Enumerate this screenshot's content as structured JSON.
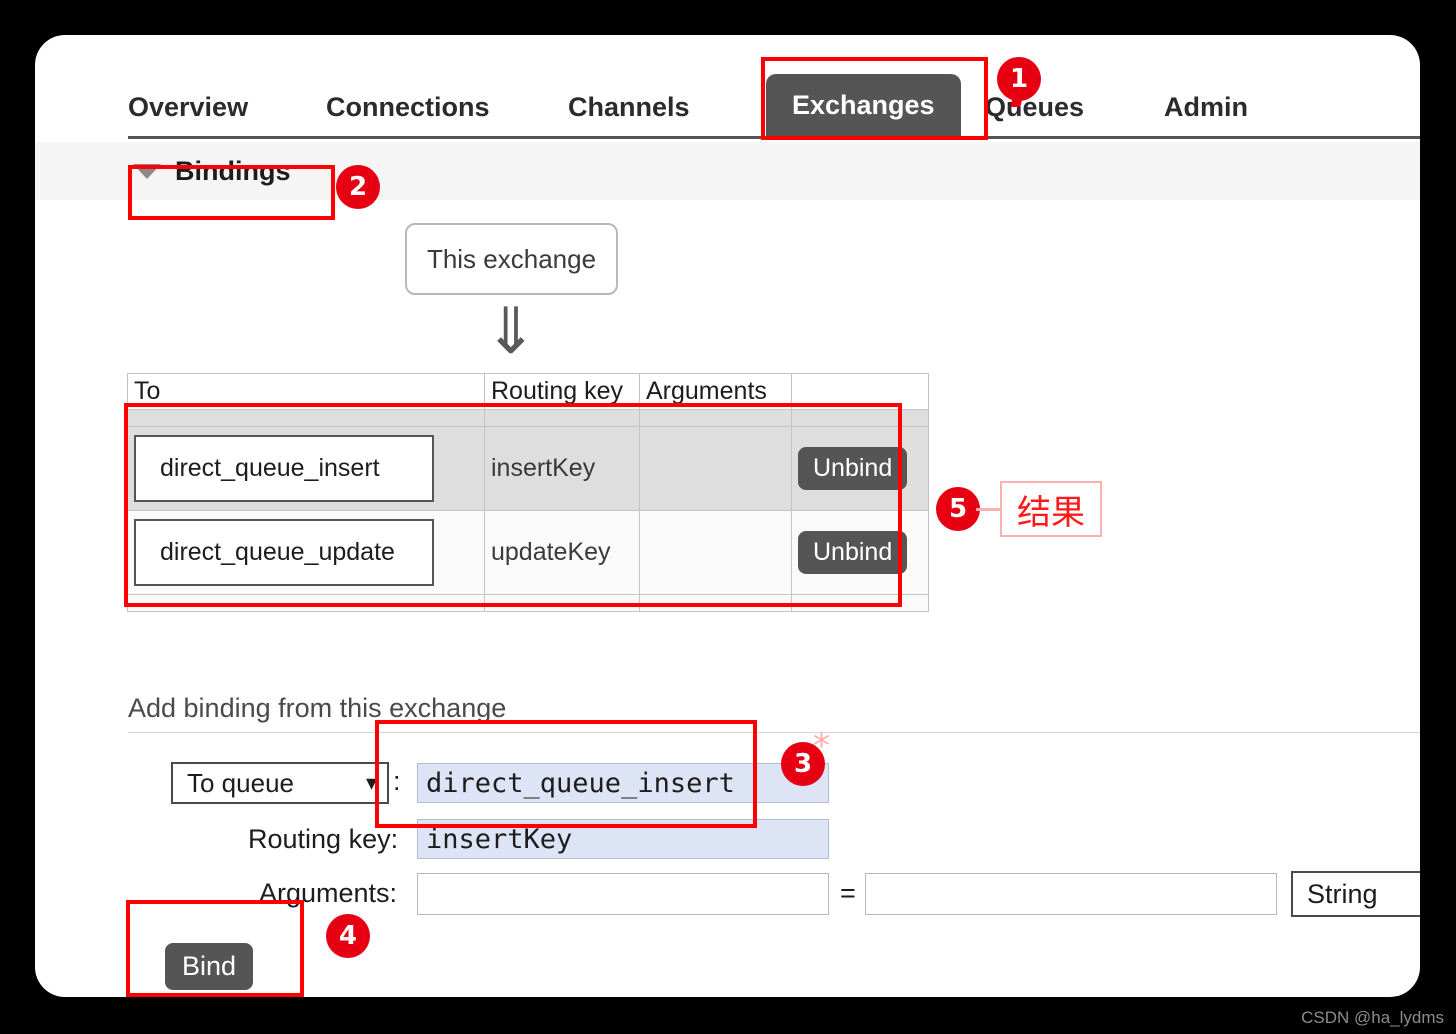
{
  "nav": {
    "tabs": [
      {
        "label": "Overview",
        "active": false
      },
      {
        "label": "Connections",
        "active": false
      },
      {
        "label": "Channels",
        "active": false
      },
      {
        "label": "Exchanges",
        "active": true
      },
      {
        "label": "Queues",
        "active": false
      },
      {
        "label": "Admin",
        "active": false
      }
    ]
  },
  "bindings_section": {
    "title": "Bindings",
    "caret_icon": "triangle-down-icon",
    "source_node_label": "This exchange",
    "flow_arrow_icon": "double-down-arrow-icon",
    "table": {
      "columns": [
        "To",
        "Routing key",
        "Arguments",
        ""
      ],
      "rows": [
        {
          "to": "direct_queue_insert",
          "routing_key": "insertKey",
          "arguments": "",
          "action_label": "Unbind"
        },
        {
          "to": "direct_queue_update",
          "routing_key": "updateKey",
          "arguments": "",
          "action_label": "Unbind"
        }
      ]
    }
  },
  "add_binding_form": {
    "title": "Add binding from this exchange",
    "destination_type": {
      "selected": "To queue",
      "chevron_icon": "chevron-down-icon"
    },
    "separator": ":",
    "destination": {
      "value": "direct_queue_insert",
      "placeholder": ""
    },
    "routing_key": {
      "label": "Routing key:",
      "value": "insertKey",
      "placeholder": ""
    },
    "arguments": {
      "label": "Arguments:",
      "key_value": "",
      "key_placeholder": "",
      "equals": "=",
      "value_value": "",
      "value_placeholder": "",
      "type_selected": "String",
      "type_chevron_icon": "chevron-down-icon"
    },
    "required_marker": "*",
    "submit_label": "Bind"
  },
  "annotations": {
    "badges": [
      "1",
      "2",
      "3",
      "4",
      "5"
    ],
    "result_callout": "结果"
  },
  "watermark": "CSDN @ha_lydms",
  "colors": {
    "annotation_red": "#e60012",
    "active_tab_bg": "#555555",
    "input_focus_bg": "#dde4f5",
    "callout_red": "#ff1a1a"
  }
}
